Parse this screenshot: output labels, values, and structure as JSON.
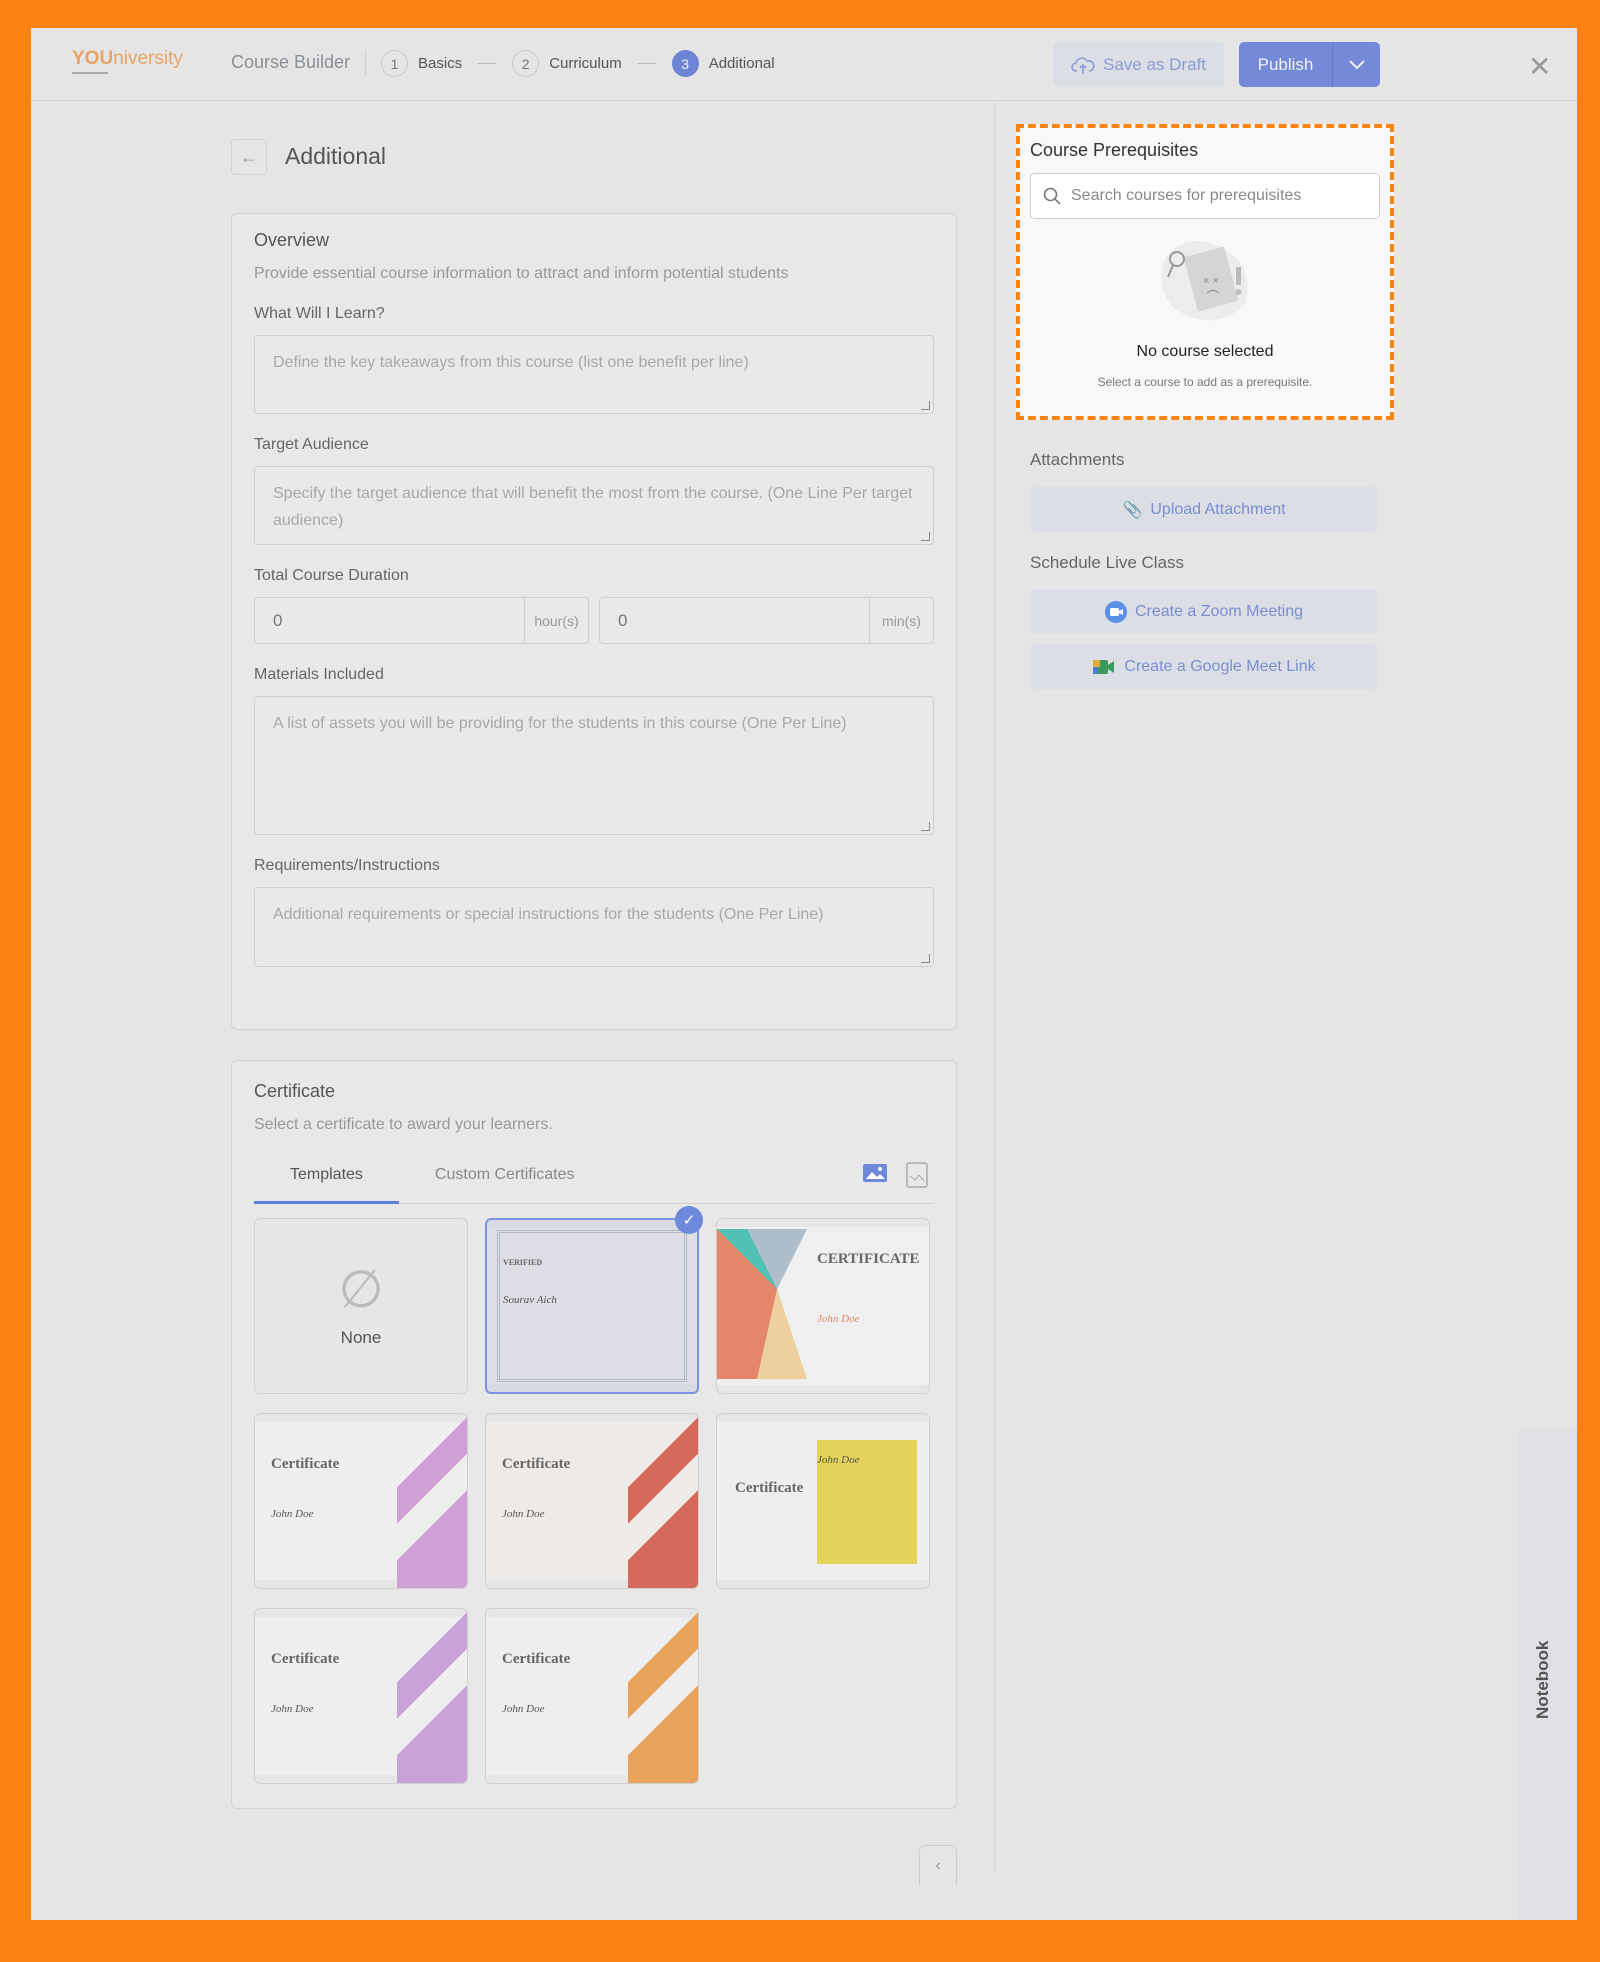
{
  "header": {
    "logo": "YOUniversity",
    "logo_bold": "YOU",
    "logo_rest": "niversity",
    "app_title": "Course Builder",
    "steps": [
      {
        "num": "1",
        "label": "Basics"
      },
      {
        "num": "2",
        "label": "Curriculum"
      },
      {
        "num": "3",
        "label": "Additional",
        "active": true
      }
    ],
    "save_draft": "Save as Draft",
    "publish": "Publish"
  },
  "page": {
    "title": "Additional"
  },
  "overview": {
    "title": "Overview",
    "description": "Provide essential course information to attract and inform potential students",
    "learn_label": "What Will I Learn?",
    "learn_placeholder": "Define the key takeaways from this course (list one benefit per line)",
    "audience_label": "Target Audience",
    "audience_placeholder": "Specify the target audience that will benefit the most from the course. (One Line Per target audience)",
    "duration_label": "Total Course Duration",
    "hours_value": "0",
    "hours_unit": "hour(s)",
    "mins_value": "0",
    "mins_unit": "min(s)",
    "materials_label": "Materials Included",
    "materials_placeholder": "A list of assets you will be providing for the students in this course (One Per Line)",
    "requirements_label": "Requirements/Instructions",
    "requirements_placeholder": "Additional requirements or special instructions for the students (One Per Line)"
  },
  "certificate": {
    "title": "Certificate",
    "description": "Select a certificate to award your learners.",
    "tabs": [
      "Templates",
      "Custom Certificates"
    ],
    "none_label": "None",
    "templates": [
      {
        "title": "VERIFIED",
        "name": "Sourav Aich",
        "selected": true
      },
      {
        "title": "CERTIFICATE",
        "name": "John Doe"
      },
      {
        "title": "Certificate",
        "name": "John Doe"
      },
      {
        "title": "Certificate",
        "name": "John Doe"
      },
      {
        "title": "Certificate",
        "name": "John Doe"
      },
      {
        "title": "Certificate",
        "name": "John Doe"
      },
      {
        "title": "Certificate",
        "name": "John Doe"
      }
    ]
  },
  "prerequisites": {
    "title": "Course Prerequisites",
    "search_placeholder": "Search courses for prerequisites",
    "empty_title": "No course selected",
    "empty_sub": "Select a course to add as a prerequisite."
  },
  "attachments": {
    "title": "Attachments",
    "upload": "Upload Attachment"
  },
  "live": {
    "title": "Schedule Live Class",
    "zoom": "Create a Zoom Meeting",
    "meet": "Create a Google Meet Link"
  },
  "notebook": "Notebook",
  "colors": {
    "accent": "#6e85d6",
    "highlight": "#ff8312"
  }
}
